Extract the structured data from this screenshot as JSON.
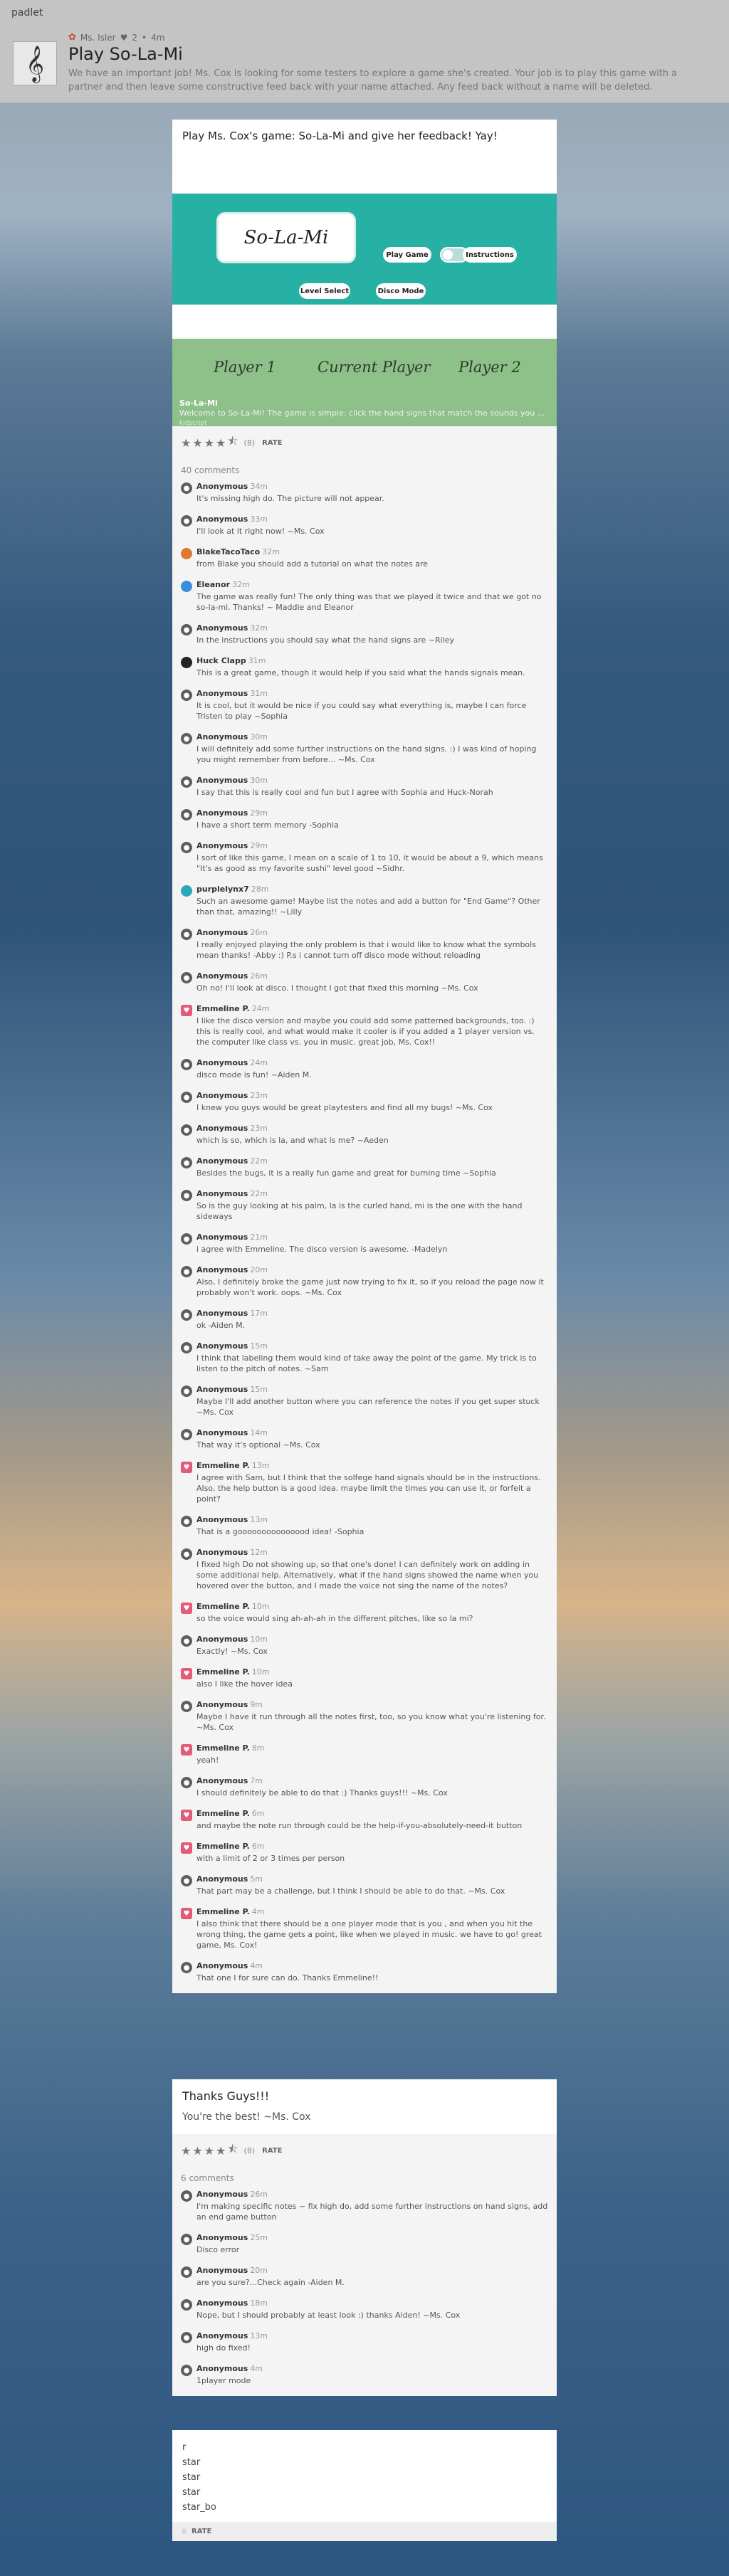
{
  "app": {
    "brand": "padlet"
  },
  "header": {
    "author": "Ms. Isler",
    "dot_sep": "•",
    "likes": "2",
    "age": "4m",
    "title": "Play So-La-Mi",
    "description": "We have an important job! Ms. Cox is looking for some testers to explore a game she's created. Your job is to play this game with a partner and then leave some constructive feed back with your name attached. Any feed back without a name will be deleted."
  },
  "post1": {
    "title": "Play Ms. Cox's game: So-La-Mi and give her feedback! Yay!",
    "preview": {
      "game_title": "So-La-Mi",
      "play_label": "Play Game",
      "instructions_label": "Instructions",
      "level_label": "Level Select",
      "disco_label": "Disco Mode",
      "player1": "Player 1",
      "current": "Current Player",
      "player2": "Player 2",
      "link_title": "So-La-Mi",
      "link_desc": "Welcome to So-La-Mi! The game is simple: click the hand signs that match the sounds you he...",
      "link_source": "kidscript"
    },
    "rating_count": "(8)",
    "rate_label": "RATE",
    "comments_count": "40 comments",
    "comments": [
      {
        "av": "anon",
        "name": "Anonymous",
        "time": "34m",
        "text": "It's missing high do. The picture will not appear."
      },
      {
        "av": "anon",
        "name": "Anonymous",
        "time": "33m",
        "text": "I'll look at it right now! ~Ms. Cox"
      },
      {
        "av": "orange",
        "name": "BlakeTacoTaco",
        "time": "32m",
        "text": "from Blake you should add a tutorial on what the notes are"
      },
      {
        "av": "blue",
        "name": "Eleanor",
        "time": "32m",
        "text": "The game was really fun! The only thing was that we played it twice and that we got no so-la-mi. Thanks! ~ Maddie and Eleanor"
      },
      {
        "av": "anon",
        "name": "Anonymous",
        "time": "32m",
        "text": "In the instructions you should say what the hand signs are ~Riley"
      },
      {
        "av": "black",
        "name": "Huck Clapp",
        "time": "31m",
        "text": "This is a great game, though it would help if you said what the hands signals mean."
      },
      {
        "av": "anon",
        "name": "Anonymous",
        "time": "31m",
        "text": "It is cool, but it would be nice if you could say what everything is, maybe I can force Tristen to play ~Sophia"
      },
      {
        "av": "anon",
        "name": "Anonymous",
        "time": "30m",
        "text": "I will definitely add some further instructions on the hand signs. :) I was kind of hoping you might remember from before... ~Ms. Cox"
      },
      {
        "av": "anon",
        "name": "Anonymous",
        "time": "30m",
        "text": "I say that this is really cool and fun but I agree with Sophia and Huck-Norah"
      },
      {
        "av": "anon",
        "name": "Anonymous",
        "time": "29m",
        "text": "I have a short term memory -Sophia"
      },
      {
        "av": "anon",
        "name": "Anonymous",
        "time": "29m",
        "text": "I sort of like this game, I mean on a scale of 1 to 10, it would be about a 9, which means \"It's as good as my favorite sushi\" level good ~Sidhr."
      },
      {
        "av": "teal",
        "name": "purplelynx7",
        "time": "28m",
        "text": "Such an awesome game! Maybe list the notes and add a button for \"End Game\"? Other than that, amazing!! ~Lilly"
      },
      {
        "av": "anon",
        "name": "Anonymous",
        "time": "26m",
        "text": "I really enjoyed playing the only problem is that i would like to know what the symbols mean thanks! -Abby :) P.s i cannot turn off disco mode without reloading"
      },
      {
        "av": "anon",
        "name": "Anonymous",
        "time": "26m",
        "text": "Oh no! I'll look at disco. I thought I got that fixed this morning ~Ms. Cox"
      },
      {
        "av": "pink",
        "name": "Emmeline P.",
        "time": "24m",
        "text": "I like the disco version and maybe you could add some patterned backgrounds, too. :) this is really cool, and what would make it cooler is if you added a 1 player version vs. the computer like class vs. you in music. great job, Ms. Cox!!"
      },
      {
        "av": "anon",
        "name": "Anonymous",
        "time": "24m",
        "text": "disco mode is fun! ~Aiden M."
      },
      {
        "av": "anon",
        "name": "Anonymous",
        "time": "23m",
        "text": "I knew you guys would be great playtesters and find all my bugs! ~Ms. Cox"
      },
      {
        "av": "anon",
        "name": "Anonymous",
        "time": "23m",
        "text": "which is so, which is la, and what is me? ~Aeden"
      },
      {
        "av": "anon",
        "name": "Anonymous",
        "time": "22m",
        "text": "Besides the bugs, it is a really fun game and great for burning time ~Sophia"
      },
      {
        "av": "anon",
        "name": "Anonymous",
        "time": "22m",
        "text": "So is the guy looking at his palm, la is the curled hand, mi is the one with the hand sideways"
      },
      {
        "av": "anon",
        "name": "Anonymous",
        "time": "21m",
        "text": "i agree with Emmeline. The disco version is awesome. -Madelyn"
      },
      {
        "av": "anon",
        "name": "Anonymous",
        "time": "20m",
        "text": "Also, I definitely broke the game just now trying to fix it, so if you reload the page now it probably won't work. oops. ~Ms. Cox"
      },
      {
        "av": "anon",
        "name": "Anonymous",
        "time": "17m",
        "text": "ok -Aiden M."
      },
      {
        "av": "anon",
        "name": "Anonymous",
        "time": "15m",
        "text": "I think that labeling them would kind of take away the point of the game. My trick is to listen to the pitch of notes. ~Sam"
      },
      {
        "av": "anon",
        "name": "Anonymous",
        "time": "15m",
        "text": "Maybe I'll add another button where you can reference the notes if you get super stuck ~Ms. Cox"
      },
      {
        "av": "anon",
        "name": "Anonymous",
        "time": "14m",
        "text": "That way it's optional ~Ms. Cox"
      },
      {
        "av": "pink",
        "name": "Emmeline P.",
        "time": "13m",
        "text": "I agree with Sam, but I think that the solfege hand signals should be in the instructions. Also, the help button is a good idea. maybe limit the times you can use it, or forfeit a point?"
      },
      {
        "av": "anon",
        "name": "Anonymous",
        "time": "13m",
        "text": "That is a gooooooooooooood idea! -Sophia"
      },
      {
        "av": "anon",
        "name": "Anonymous",
        "time": "12m",
        "text": "I fixed high Do not showing up, so that one's done! I can definitely work on adding in some additional help. Alternatively, what if the hand signs showed the name when you hovered over the button, and I made the voice not sing the name of the notes?"
      },
      {
        "av": "pink",
        "name": "Emmeline P.",
        "time": "10m",
        "text": "so the voice would sing ah-ah-ah in the different pitches, like so la mi?"
      },
      {
        "av": "anon",
        "name": "Anonymous",
        "time": "10m",
        "text": "Exactly! ~Ms. Cox"
      },
      {
        "av": "pink",
        "name": "Emmeline P.",
        "time": "10m",
        "text": "also I like the hover idea"
      },
      {
        "av": "anon",
        "name": "Anonymous",
        "time": "9m",
        "text": "Maybe I have it run through all the notes first, too, so you know what you're listening for. ~Ms. Cox"
      },
      {
        "av": "pink",
        "name": "Emmeline P.",
        "time": "8m",
        "text": "yeah!"
      },
      {
        "av": "anon",
        "name": "Anonymous",
        "time": "7m",
        "text": "I should definitely be able to do that :) Thanks guys!!! ~Ms. Cox"
      },
      {
        "av": "pink",
        "name": "Emmeline P.",
        "time": "6m",
        "text": "and maybe the note run through could be the help-if-you-absolutely-need-it button"
      },
      {
        "av": "pink",
        "name": "Emmeline P.",
        "time": "6m",
        "text": "with a limit of 2 or 3 times per person"
      },
      {
        "av": "anon",
        "name": "Anonymous",
        "time": "5m",
        "text": "That part may be a challenge, but I think I should be able to do that. ~Ms. Cox"
      },
      {
        "av": "pink",
        "name": "Emmeline P.",
        "time": "4m",
        "text": "I also think that there should be a one player mode that is you , and when you hit the wrong thing, the game gets a point, like when we played in music. we have to go! great game, Ms. Cox!"
      },
      {
        "av": "anon",
        "name": "Anonymous",
        "time": "4m",
        "text": "That one I for sure can do. Thanks Emmeline!!"
      }
    ]
  },
  "post2": {
    "title": "Thanks Guys!!!",
    "body": "You're the best! ~Ms. Cox",
    "rating_count": "(8)",
    "rate_label": "RATE",
    "comments_count": "6 comments",
    "comments": [
      {
        "av": "anon",
        "name": "Anonymous",
        "time": "26m",
        "text": "I'm making specific notes ~ fix high do, add some further instructions on hand signs, add an end game button"
      },
      {
        "av": "anon",
        "name": "Anonymous",
        "time": "25m",
        "text": "Disco error"
      },
      {
        "av": "anon",
        "name": "Anonymous",
        "time": "20m",
        "text": "are you sure?...Check again -Aiden M."
      },
      {
        "av": "anon",
        "name": "Anonymous",
        "time": "18m",
        "text": "Nope, but I should probably at least look :) thanks Aiden! ~Ms. Cox"
      },
      {
        "av": "anon",
        "name": "Anonymous",
        "time": "13m",
        "text": "high do fixed!"
      },
      {
        "av": "anon",
        "name": "Anonymous",
        "time": "4m",
        "text": "1player mode"
      }
    ]
  },
  "post3": {
    "lines": [
      "r",
      "star",
      "star",
      "star",
      "star_bo"
    ],
    "rate_label": "RATE"
  }
}
